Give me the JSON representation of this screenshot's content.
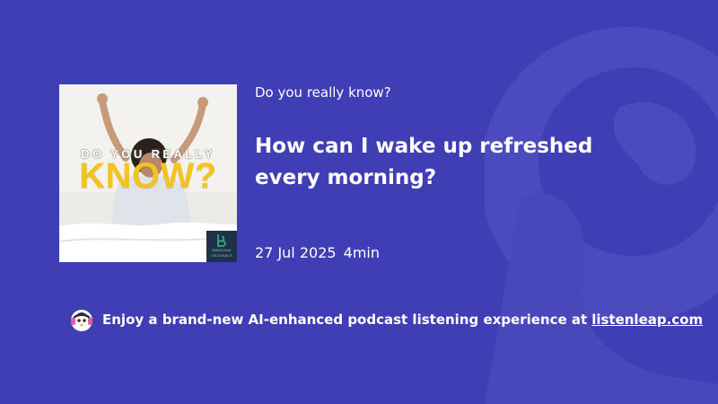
{
  "podcast": {
    "show_name": "Do you really know?",
    "cover": {
      "line1": "DO YOU REALLY",
      "line2": "KNOW?",
      "brand_text_1": "BABAGAM",
      "brand_text_2": "ORIGINALS",
      "yellow": "#f4c320",
      "brand_green": "#2fae7a"
    }
  },
  "episode": {
    "title": "How can I wake up refreshed every morning?",
    "date": "27 Jul 2025",
    "duration": "4min"
  },
  "promo": {
    "logo_icon": "penguin-headphones-icon",
    "text": "Enjoy a brand-new AI-enhanced podcast listening experience at",
    "link_text": "listenleap.com"
  },
  "colors": {
    "background": "#3f3eb5",
    "watermark": "#5354c1"
  }
}
